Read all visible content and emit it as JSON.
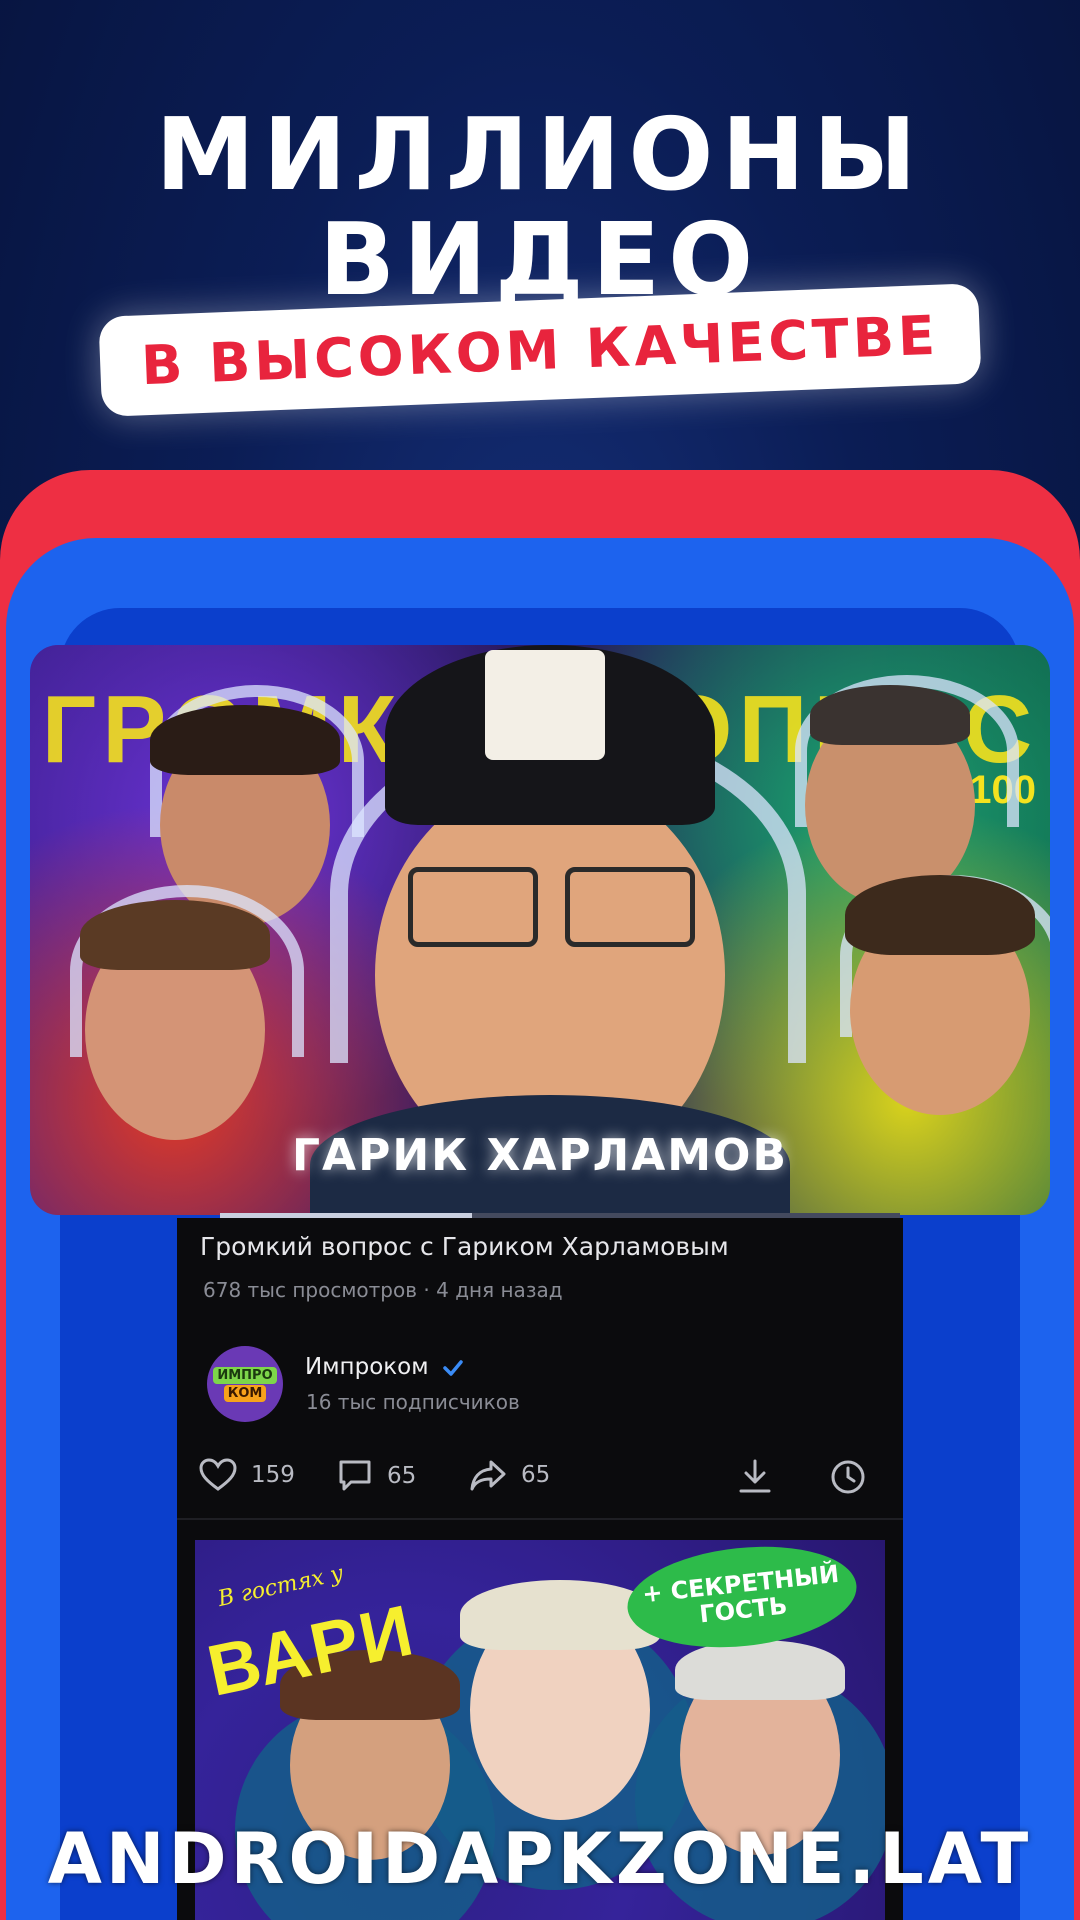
{
  "promo": {
    "headline_line1": "МИЛЛИОНЫ",
    "headline_line2": "ВИДЕО",
    "badge_text": "В ВЫСОКОМ КАЧЕСТВЕ"
  },
  "featured_video": {
    "thumbnail_title": "ГРОМКИЙ ВОПРОС",
    "thumbnail_prize": "₽100",
    "thumbnail_caption": "ГАРИК ХАРЛАМОВ",
    "playback_progress_percent": 37,
    "title": "Громкий вопрос с Гариком Харламовым",
    "views": "678 тыс просмотров",
    "separator": "·",
    "published": "4 дня назад",
    "channel": {
      "name": "Импроком",
      "verified": true,
      "subscribers": "16 тыс подписчиков",
      "avatar_line1": "ИМПРО",
      "avatar_line2": "КОМ"
    },
    "actions": {
      "likes": "159",
      "comments": "65",
      "shares": "65"
    }
  },
  "next_video": {
    "thumbnail_small_text": "В гостях у",
    "thumbnail_big_text": "ВАРИ",
    "badge_text": "+ СЕКРЕТНЫЙ ГОСТЬ"
  },
  "watermark": "ANDROIDAPKZONE.LAT",
  "colors": {
    "background": "#0b1d55",
    "accent_red": "#ee2f43",
    "accent_blue": "#1d63ee",
    "badge_text": "#e8243d",
    "verified": "#3a8bf5"
  },
  "icons": [
    "heart-icon",
    "comment-icon",
    "share-icon",
    "download-icon",
    "watch-later-icon",
    "verified-icon"
  ]
}
